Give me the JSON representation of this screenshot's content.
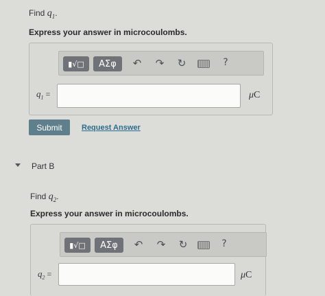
{
  "partA": {
    "find_prefix": "Find ",
    "find_var": "q",
    "find_sub": "1",
    "find_suffix": ".",
    "instruction": "Express your answer in microcoulombs.",
    "toolbar": {
      "templates_icon": "templates-icon",
      "greek_label": "ΑΣφ",
      "undo_icon": "undo-icon",
      "redo_icon": "redo-icon",
      "reset_icon": "reset-icon",
      "keyboard_icon": "keyboard-icon",
      "help_label": "?"
    },
    "input_label_var": "q",
    "input_label_sub": "1",
    "input_label_eq": " =",
    "input_value": "",
    "unit_prefix": "μ",
    "unit_rest": "C",
    "submit_label": "Submit",
    "request_label": "Request Answer"
  },
  "partB": {
    "title": "Part B",
    "find_prefix": "Find ",
    "find_var": "q",
    "find_sub": "2",
    "find_suffix": ".",
    "instruction": "Express your answer in microcoulombs.",
    "toolbar": {
      "greek_label": "ΑΣφ",
      "help_label": "?"
    },
    "input_label_var": "q",
    "input_label_sub": "2",
    "input_label_eq": " =",
    "input_value": "",
    "unit_prefix": "μ",
    "unit_rest": "C"
  }
}
